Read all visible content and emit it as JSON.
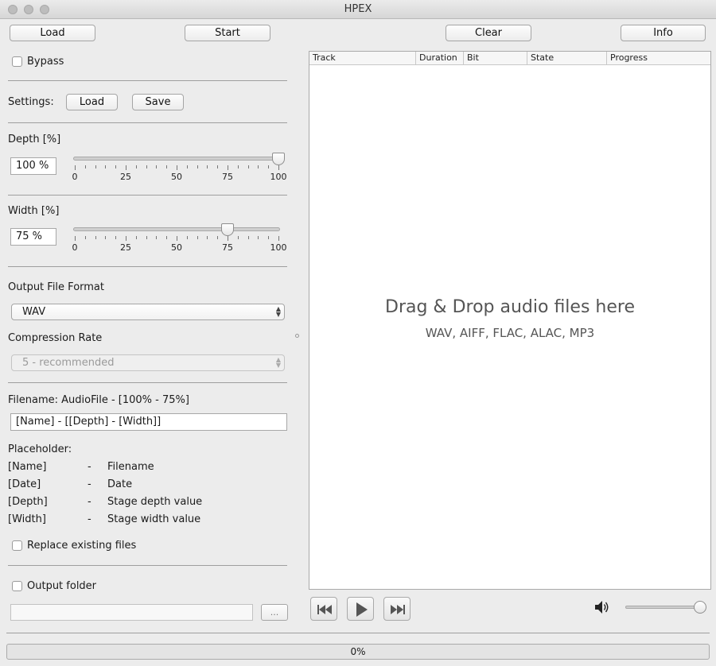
{
  "window": {
    "title": "HPEX"
  },
  "toolbar": {
    "load": "Load",
    "start": "Start",
    "clear": "Clear",
    "info": "Info"
  },
  "bypass": {
    "label": "Bypass",
    "checked": false
  },
  "settings": {
    "label": "Settings:",
    "load": "Load",
    "save": "Save"
  },
  "depth": {
    "label": "Depth [%]",
    "value_text": "100 %",
    "value": 100,
    "ticks": [
      "0",
      "25",
      "50",
      "75",
      "100"
    ]
  },
  "width": {
    "label": "Width [%]",
    "value_text": "75 %",
    "value": 75,
    "ticks": [
      "0",
      "25",
      "50",
      "75",
      "100"
    ]
  },
  "output_format": {
    "label": "Output File Format",
    "selected": "WAV"
  },
  "compression": {
    "label": "Compression Rate",
    "selected": "5 - recommended",
    "enabled": false
  },
  "filename": {
    "label": "Filename: AudioFile - [100% - 75%]",
    "pattern": "[Name] - [[Depth] - [Width]]"
  },
  "placeholders": {
    "title": "Placeholder:",
    "rows": [
      {
        "key": "[Name]",
        "dash": "-",
        "desc": "Filename"
      },
      {
        "key": "[Date]",
        "dash": "-",
        "desc": "Date"
      },
      {
        "key": "[Depth]",
        "dash": "-",
        "desc": "Stage depth value"
      },
      {
        "key": "[Width]",
        "dash": "-",
        "desc": "Stage width value"
      }
    ]
  },
  "replace_existing": {
    "label": "Replace existing files",
    "checked": false
  },
  "output_folder": {
    "label": "Output folder",
    "checked": false,
    "path": "",
    "browse": "..."
  },
  "track_table": {
    "columns": [
      "Track",
      "Duration",
      "Bit",
      "State",
      "Progress"
    ],
    "drop_title": "Drag & Drop audio files here",
    "drop_formats": "WAV, AIFF, FLAC, ALAC, MP3"
  },
  "transport": {
    "volume": 100
  },
  "status": {
    "progress_text": "0%",
    "progress": 0
  }
}
